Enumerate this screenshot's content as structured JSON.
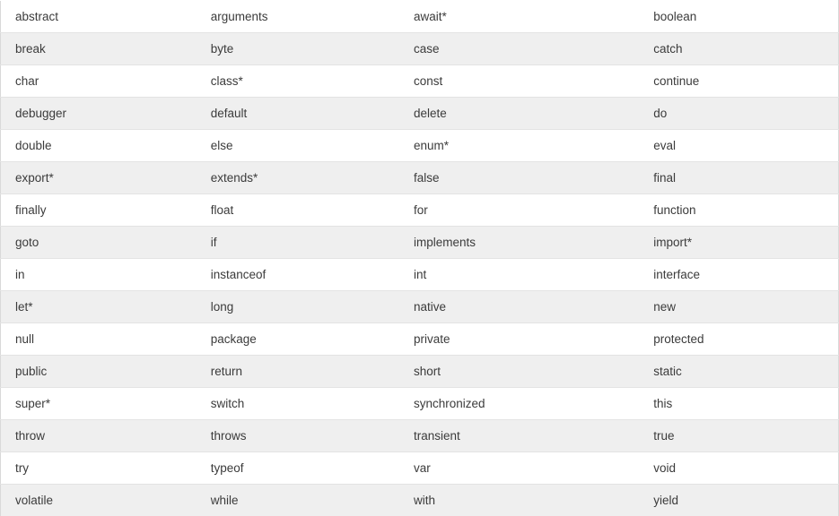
{
  "table": {
    "name": "reserved-keywords-table",
    "column_count": 4,
    "row_count": 16,
    "colors": {
      "text": "#3b3b3b",
      "row_odd_background": "#ffffff",
      "row_even_background": "#efefef",
      "row_border": "#e3e3e3",
      "table_border": "#d9d9d9"
    },
    "rows": [
      [
        "abstract",
        "arguments",
        "await*",
        "boolean"
      ],
      [
        "break",
        "byte",
        "case",
        "catch"
      ],
      [
        "char",
        "class*",
        "const",
        "continue"
      ],
      [
        "debugger",
        "default",
        "delete",
        "do"
      ],
      [
        "double",
        "else",
        "enum*",
        "eval"
      ],
      [
        "export*",
        "extends*",
        "false",
        "final"
      ],
      [
        "finally",
        "float",
        "for",
        "function"
      ],
      [
        "goto",
        "if",
        "implements",
        "import*"
      ],
      [
        "in",
        "instanceof",
        "int",
        "interface"
      ],
      [
        "let*",
        "long",
        "native",
        "new"
      ],
      [
        "null",
        "package",
        "private",
        "protected"
      ],
      [
        "public",
        "return",
        "short",
        "static"
      ],
      [
        "super*",
        "switch",
        "synchronized",
        "this"
      ],
      [
        "throw",
        "throws",
        "transient",
        "true"
      ],
      [
        "try",
        "typeof",
        "var",
        "void"
      ],
      [
        "volatile",
        "while",
        "with",
        "yield"
      ]
    ]
  }
}
